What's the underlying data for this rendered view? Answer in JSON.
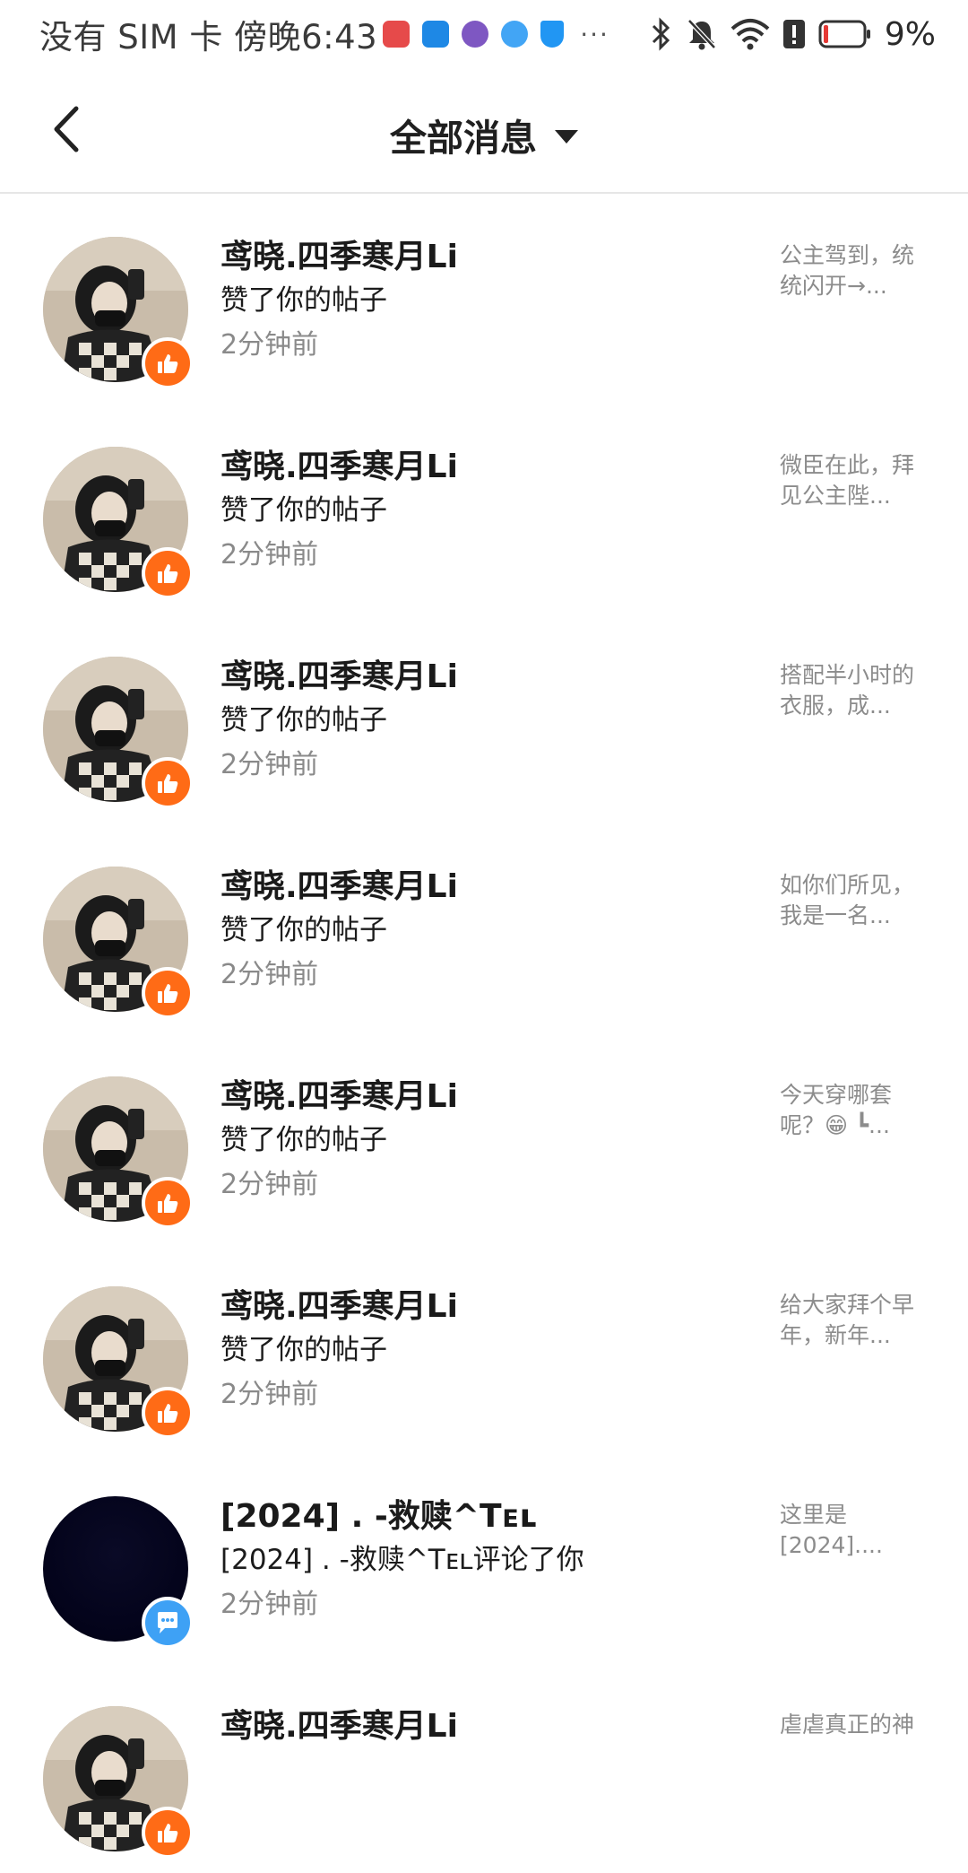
{
  "status_bar": {
    "left_text": "没有 SIM 卡 傍晚6:43",
    "more_text": "···",
    "battery": "9%",
    "colors": {
      "battery_low": "#e53935"
    },
    "app_icons": [
      "red-book-app-icon",
      "weather-app-icon",
      "music-app-icon",
      "browser-app-icon",
      "security-shield-app-icon"
    ]
  },
  "nav": {
    "title": "全部消息",
    "back_icon": "chevron-left-icon",
    "dropdown_icon": "caret-down-icon"
  },
  "colors": {
    "like_badge": "#ff6b16",
    "comment_badge": "#3ea1f5",
    "secondary_text": "#8a8a8a"
  },
  "messages": [
    {
      "name": "鸢晓.四季寒月Li",
      "action": "赞了你的帖子",
      "time": "2分钟前",
      "preview": "公主驾到，统统闪开→...",
      "badge": "like"
    },
    {
      "name": "鸢晓.四季寒月Li",
      "action": "赞了你的帖子",
      "time": "2分钟前",
      "preview": "微臣在此，拜见公主陛...",
      "badge": "like"
    },
    {
      "name": "鸢晓.四季寒月Li",
      "action": "赞了你的帖子",
      "time": "2分钟前",
      "preview": "搭配半小时的衣服，成...",
      "badge": "like"
    },
    {
      "name": "鸢晓.四季寒月Li",
      "action": "赞了你的帖子",
      "time": "2分钟前",
      "preview": "如你们所见，我是一名...",
      "badge": "like"
    },
    {
      "name": "鸢晓.四季寒月Li",
      "action": "赞了你的帖子",
      "time": "2分钟前",
      "preview": "今天穿哪套呢？😁 ┗...",
      "badge": "like"
    },
    {
      "name": "鸢晓.四季寒月Li",
      "action": "赞了你的帖子",
      "time": "2分钟前",
      "preview": "给大家拜个早年，新年...",
      "badge": "like"
    },
    {
      "name": "[2024] . -救赎^Tᴇʟ",
      "action": "[2024] . -救赎^Tᴇʟ评论了你",
      "time": "2分钟前",
      "preview": "这里是[2024]....",
      "badge": "comment"
    },
    {
      "name": "鸢晓.四季寒月Li",
      "action": "",
      "time": "",
      "preview": "虐虐真正的神",
      "badge": "like"
    }
  ]
}
